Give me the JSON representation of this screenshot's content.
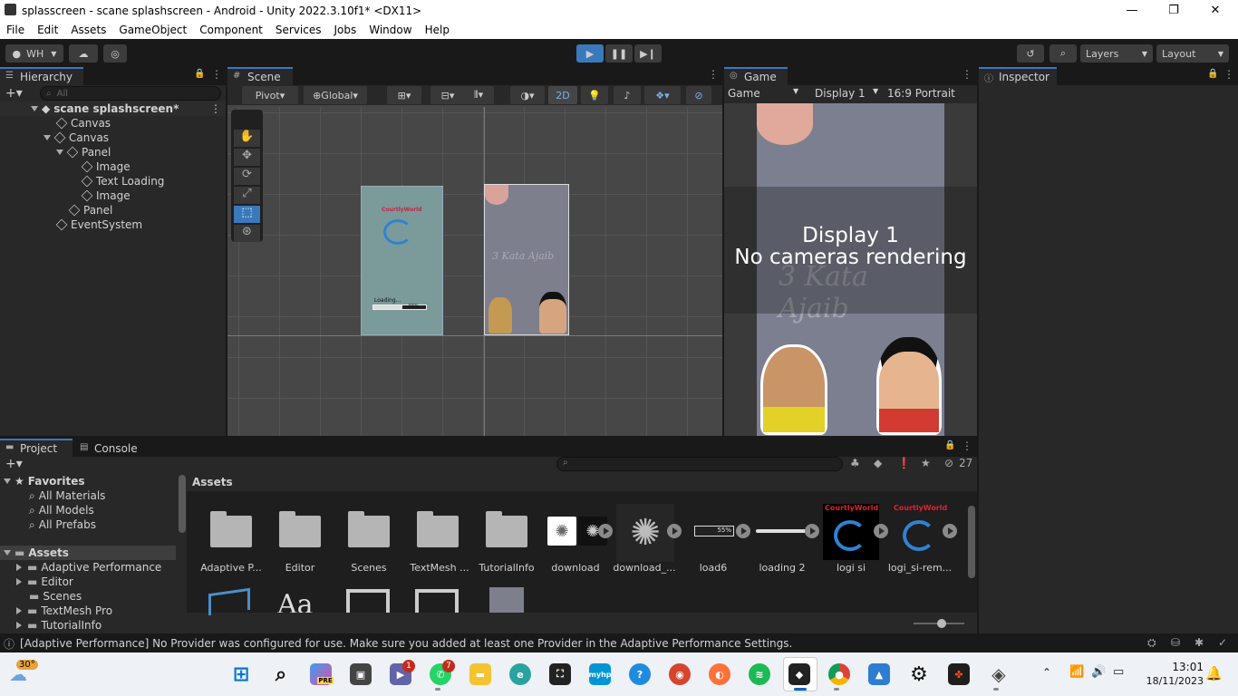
{
  "window": {
    "title": "splasscreen - scane splashscreen - Android - Unity 2022.3.10f1* <DX11>",
    "minimize": "—",
    "maximize": "❐",
    "close": "✕"
  },
  "menu": [
    "File",
    "Edit",
    "Assets",
    "GameObject",
    "Component",
    "Services",
    "Jobs",
    "Window",
    "Help"
  ],
  "toolbar": {
    "account": "WH",
    "layers": "Layers",
    "layout": "Layout"
  },
  "hierarchy": {
    "tab": "Hierarchy",
    "search_placeholder": "All",
    "scene": "scane splashscreen*",
    "items": [
      "Canvas",
      "Canvas",
      "Panel",
      "Image",
      "Text Loading",
      "Image",
      "Panel",
      "EventSystem"
    ]
  },
  "scene": {
    "tab": "Scene",
    "pivot": "Pivot",
    "global": "Global",
    "mode_2d": "2D",
    "preview_left": {
      "brand": "CourtlyWorld",
      "loading": "Loading...",
      "percent": "55%"
    },
    "preview_right": {
      "title": "3 Kata Ajaib"
    }
  },
  "game": {
    "tab": "Game",
    "mode": "Game",
    "display": "Display 1",
    "aspect": "16:9 Portrait",
    "overlay_line1": "Display 1",
    "overlay_line2": "No cameras rendering",
    "bg_title": "3 Kata Ajaib"
  },
  "inspector": {
    "tab": "Inspector"
  },
  "project": {
    "tab_project": "Project",
    "tab_console": "Console",
    "favorites_label": "Favorites",
    "favorites": [
      "All Materials",
      "All Models",
      "All Prefabs"
    ],
    "assets_label": "Assets",
    "tree": [
      "Adaptive Performance",
      "Editor",
      "Scenes",
      "TextMesh Pro",
      "TutorialInfo"
    ],
    "breadcrumb": "Assets",
    "hidden_count": "27",
    "assets": [
      "Adaptive P...",
      "Editor",
      "Scenes",
      "TextMesh ...",
      "TutorialInfo",
      "download",
      "download_...",
      "load6",
      "loading 2",
      "logi si",
      "logi_si-rem..."
    ],
    "load6_percent": "55%",
    "logo_brand": "CourtlyWorld"
  },
  "console_message": "[Adaptive Performance] No Provider was configured for use. Make sure you added at least one Provider in the Adaptive Performance Settings.",
  "taskbar": {
    "weather": "30°",
    "badge_teams": "1",
    "badge_whatsapp": "7",
    "time": "13:01",
    "date": "18/11/2023",
    "copilot_label": "PRE",
    "myhp": "myhp"
  },
  "colors": {
    "accent": "#3a79bb",
    "panel": "#282828",
    "bg": "#191919",
    "game_bg": "#7b7f8f"
  }
}
